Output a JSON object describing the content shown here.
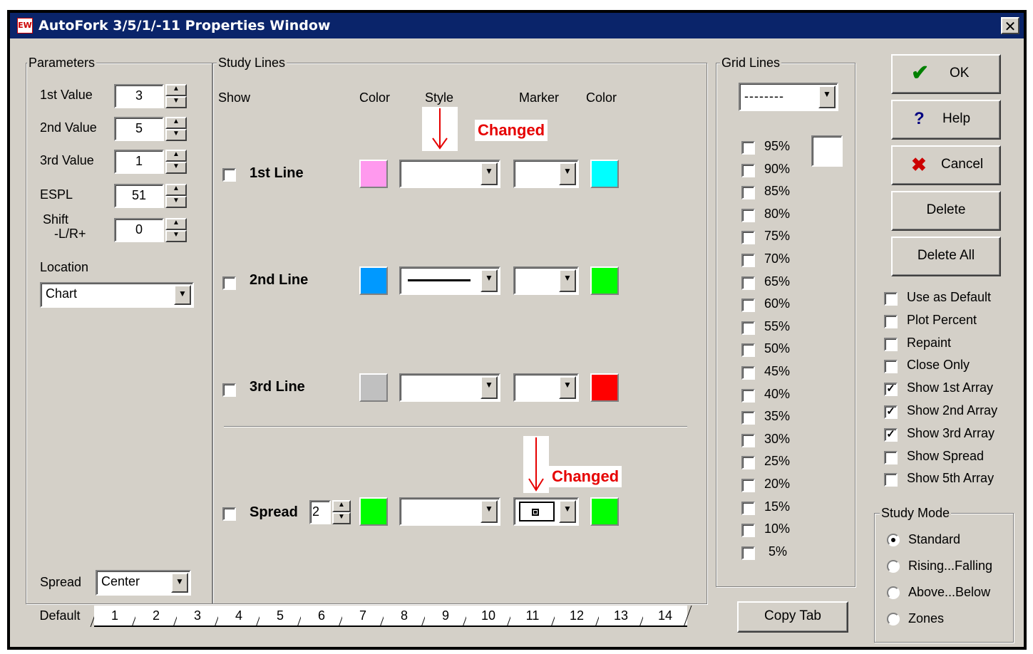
{
  "window": {
    "title": "AutoFork 3/5/1/-11 Properties Window",
    "icon": "ew-app-icon",
    "close": "✕"
  },
  "parameters": {
    "label": "Parameters",
    "first_value": {
      "label": "1st Value",
      "value": "3"
    },
    "second_value": {
      "label": "2nd Value",
      "value": "5"
    },
    "third_value": {
      "label": "3rd Value",
      "value": "1"
    },
    "espl": {
      "label": "ESPL",
      "value": "51"
    },
    "shift": {
      "label_line1": "Shift",
      "label_line2": "-L/R+",
      "value": "0"
    },
    "location": {
      "label": "Location",
      "value": "Chart"
    },
    "spread": {
      "label": "Spread",
      "value": "Center"
    }
  },
  "study_lines": {
    "label": "Study Lines",
    "headers": {
      "show": "Show",
      "color": "Color",
      "style": "Style",
      "marker": "Marker",
      "color2": "Color"
    },
    "changed_label": "Changed",
    "lines": [
      {
        "label": "1st Line",
        "color": "#ff99ee",
        "marker_color": "#00ffff",
        "style": "none"
      },
      {
        "label": "2nd Line",
        "color": "#0099ff",
        "marker_color": "#00ff00",
        "style": "solid"
      },
      {
        "label": "3rd Line",
        "color": "#c0c0c0",
        "marker_color": "#ff0000",
        "style": "none"
      }
    ],
    "spread": {
      "label": "Spread",
      "value": "2",
      "color": "#00ff00",
      "marker_color": "#00ff00"
    }
  },
  "grid_lines": {
    "label": "Grid Lines",
    "style_value": "--------",
    "percents": [
      "95%",
      "90%",
      "85%",
      "80%",
      "75%",
      "70%",
      "65%",
      "60%",
      "55%",
      "50%",
      "45%",
      "40%",
      "35%",
      "30%",
      "25%",
      "20%",
      "15%",
      "10%",
      "5%"
    ]
  },
  "buttons": {
    "ok": "OK",
    "help": "Help",
    "cancel": "Cancel",
    "delete": "Delete",
    "delete_all": "Delete All",
    "copy_tab": "Copy Tab"
  },
  "options": [
    {
      "label": "Use as Default",
      "checked": false
    },
    {
      "label": "Plot Percent",
      "checked": false
    },
    {
      "label": "Repaint",
      "checked": false
    },
    {
      "label": "Close Only",
      "checked": false
    },
    {
      "label": "Show 1st Array",
      "checked": true
    },
    {
      "label": "Show 2nd Array",
      "checked": true
    },
    {
      "label": "Show 3rd Array",
      "checked": true
    },
    {
      "label": "Show Spread",
      "checked": false
    },
    {
      "label": "Show 5th Array",
      "checked": false
    }
  ],
  "study_mode": {
    "label": "Study Mode",
    "options": [
      "Standard",
      "Rising...Falling",
      "Above...Below",
      "Zones"
    ],
    "selected": "Standard"
  },
  "tabs": [
    "Default",
    "1",
    "2",
    "3",
    "4",
    "5",
    "6",
    "7",
    "8",
    "9",
    "10",
    "11",
    "12",
    "13",
    "14"
  ]
}
